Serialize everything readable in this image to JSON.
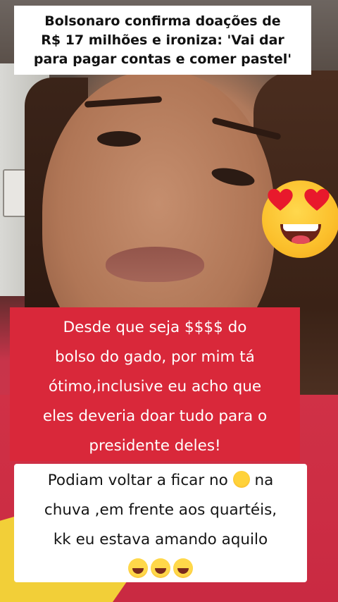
{
  "headline": {
    "lines": [
      "Bolsonaro confirma doações de",
      "R$ 17 milhões e ironiza: 'Vai dar",
      "para pagar contas e comer pastel'"
    ]
  },
  "comment_red": {
    "lines": [
      "Desde que seja $$$$ do",
      "bolso do gado, por mim tá",
      "ótimo,inclusive eu acho que",
      "eles deveria doar tudo para o",
      "presidente deles!"
    ]
  },
  "comment_white": {
    "line1_before": "Podiam voltar a ficar no",
    "line1_after": "na",
    "line2": "chuva ,em frente aos quartéis,",
    "line3": "kk eu estava amando aquilo",
    "inline_icon": "sun-emoji",
    "trailing_icons": [
      "grinning-sweat-emoji",
      "rofl-emoji",
      "rofl-emoji"
    ]
  },
  "overlay_icon": "heart-eyes-emoji",
  "colors": {
    "red_box": "#d9283a",
    "white_box": "#ffffff",
    "emoji_yellow": "#fbbf2b",
    "heart_red": "#e8192c"
  }
}
